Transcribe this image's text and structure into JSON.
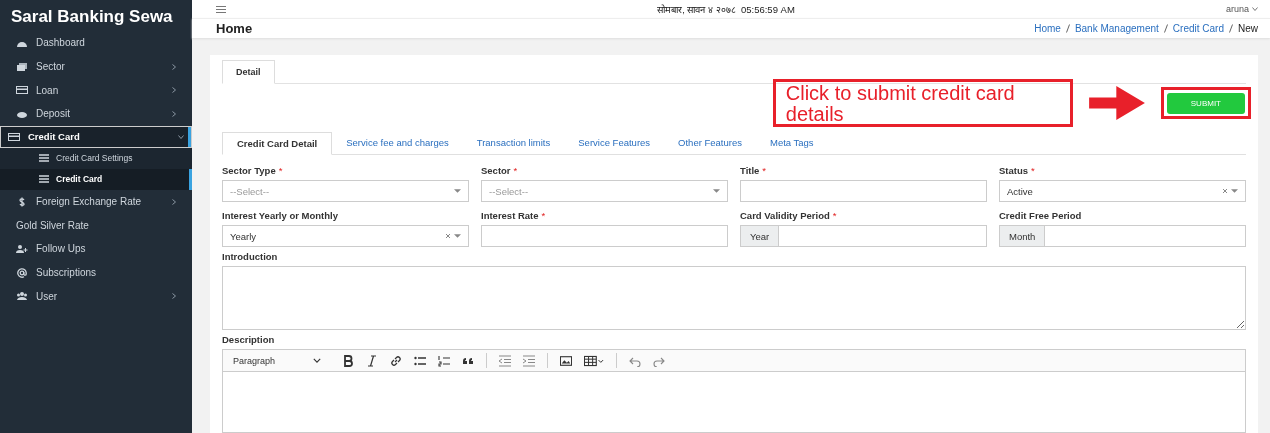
{
  "sidebar": {
    "brand": "Saral Banking Sewa",
    "items": [
      {
        "label": "Dashboard",
        "has_children": false,
        "selected": false
      },
      {
        "label": "Sector",
        "has_children": true,
        "expanded": false,
        "selected": false
      },
      {
        "label": "Loan",
        "has_children": true,
        "expanded": false,
        "selected": false
      },
      {
        "label": "Deposit",
        "has_children": true,
        "expanded": false,
        "selected": false
      },
      {
        "label": "Credit Card",
        "has_children": true,
        "expanded": true,
        "selected": true,
        "children": [
          {
            "label": "Credit Card Settings",
            "selected": false
          },
          {
            "label": "Credit Card",
            "selected": true
          }
        ]
      },
      {
        "label": "Foreign Exchange Rate",
        "has_children": true,
        "expanded": false,
        "selected": false
      },
      {
        "label": "Gold Silver Rate",
        "has_children": false,
        "selected": false
      },
      {
        "label": "Follow Ups",
        "has_children": false,
        "selected": false
      },
      {
        "label": "Subscriptions",
        "has_children": false,
        "selected": false
      },
      {
        "label": "User",
        "has_children": true,
        "expanded": false,
        "selected": false
      }
    ]
  },
  "topbar": {
    "datetime": "सोमबार, सावन ४ २०७८",
    "time": "05:56:59 AM",
    "user": "aruna"
  },
  "header": {
    "title": "Home",
    "breadcrumb": [
      {
        "label": "Home",
        "link": true
      },
      {
        "label": "Bank Management",
        "link": true
      },
      {
        "label": "Credit Card",
        "link": true
      },
      {
        "label": "New",
        "link": false
      }
    ]
  },
  "outer_tabs": [
    {
      "label": "Detail",
      "selected": true
    }
  ],
  "submit_button": "SUBMIT",
  "callout": {
    "text": "Click to submit credit card details"
  },
  "inner_tabs": [
    {
      "label": "Credit Card Detail",
      "selected": true
    },
    {
      "label": "Service fee and charges",
      "selected": false
    },
    {
      "label": "Transaction limits",
      "selected": false
    },
    {
      "label": "Service Features",
      "selected": false
    },
    {
      "label": "Other Features",
      "selected": false
    },
    {
      "label": "Meta Tags",
      "selected": false
    }
  ],
  "fields": [
    {
      "label": "Sector Type",
      "required_mark": "*",
      "kind": "select",
      "placeholder": "--Select--"
    },
    {
      "label": "Sector",
      "required_mark": "*",
      "kind": "select",
      "placeholder": "--Select--"
    },
    {
      "label": "Title",
      "required_mark": "*",
      "kind": "text"
    },
    {
      "label": "Status",
      "required_mark": "*",
      "kind": "select",
      "value": "Active",
      "clearable": true
    },
    {
      "label": "Interest Yearly or Monthly",
      "kind": "select",
      "value": "Yearly",
      "clearable": true
    },
    {
      "label": "Interest Rate",
      "required_mark": "*",
      "kind": "text"
    },
    {
      "label": "Card Validity Period",
      "required_mark": "*",
      "kind": "addon",
      "addon": "Year"
    },
    {
      "label": "Credit Free Period",
      "kind": "addon",
      "addon": "Month"
    }
  ],
  "introduction": {
    "label": "Introduction"
  },
  "description": {
    "label": "Description",
    "format": "Paragraph"
  }
}
